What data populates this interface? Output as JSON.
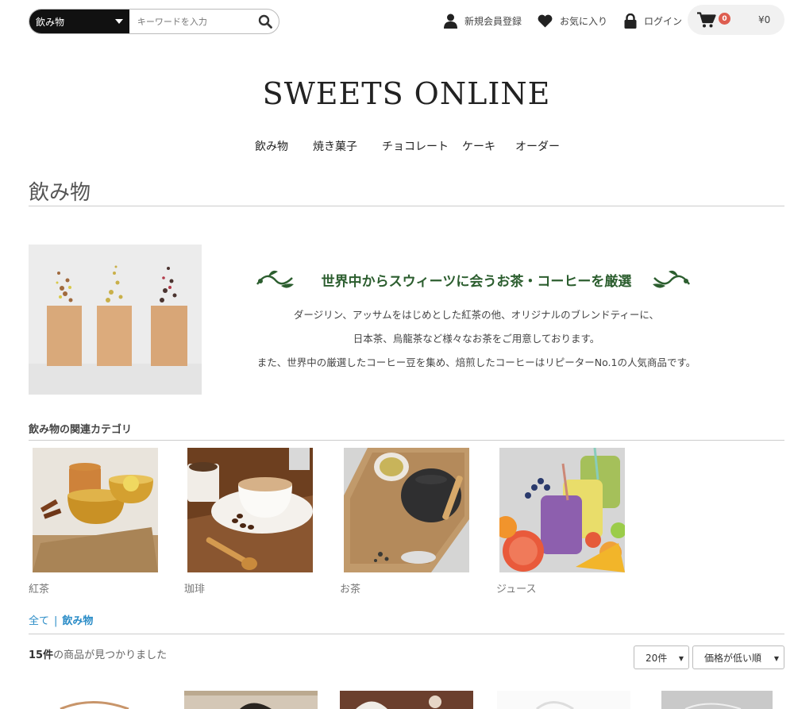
{
  "header": {
    "search": {
      "category": "飲み物",
      "placeholder": "キーワードを入力"
    },
    "links": {
      "register": "新規会員登録",
      "favorites": "お気に入り",
      "login": "ログイン"
    },
    "cart": {
      "count": "0",
      "total": "¥0"
    }
  },
  "logo": {
    "line": "SWEETS ONLINE"
  },
  "nav": [
    "飲み物",
    "焼き菓子",
    "チョコレート",
    "ケーキ",
    "オーダー"
  ],
  "page_title": "飲み物",
  "promo": {
    "title": "世界中からスウィーツに会うお茶・コーヒーを厳選",
    "lines": [
      "ダージリン、アッサムをはじめとした紅茶の他、オリジナルのブレンドティーに、",
      "日本茶、烏龍茶など様々なお茶をご用意しております。",
      "また、世界中の厳選したコーヒー豆を集め、焙煎したコーヒーはリピーターNo.1の人気商品です。"
    ]
  },
  "related": {
    "heading": "飲み物の関連カテゴリ",
    "items": [
      "紅茶",
      "珈琲",
      "お茶",
      "ジュース"
    ]
  },
  "breadcrumb": {
    "all": "全て",
    "separator": "|",
    "current": "飲み物"
  },
  "results": {
    "count": "15件",
    "suffix": "の商品が見つかりました"
  },
  "sort": {
    "per_page": "20件",
    "order": "価格が低い順"
  },
  "colors": {
    "accent_green": "#2c5e2f",
    "link_blue": "#2a8cc7",
    "badge_red": "#de5d50"
  }
}
